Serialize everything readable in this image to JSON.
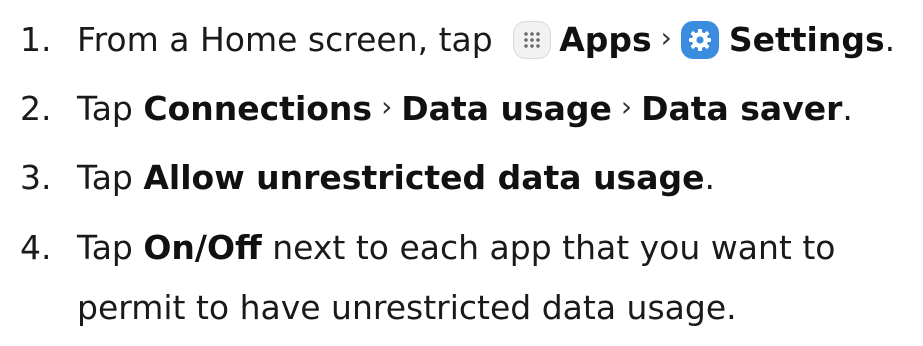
{
  "steps": [
    {
      "num": "1.",
      "t1": "From a Home screen, tap ",
      "apps": "Apps",
      "sep1": "›",
      "settings": "Settings",
      "end": ".",
      "apps_icon": "apps-grid-icon",
      "settings_icon": "gear-icon",
      "settings_icon_color": "#3a8dde"
    },
    {
      "num": "2.",
      "t1": "Tap ",
      "b1": "Connections",
      "sep1": "›",
      "b2": "Data usage",
      "sep2": "›",
      "b3": "Data saver",
      "end": "."
    },
    {
      "num": "3.",
      "t1": "Tap ",
      "b1": "Allow unrestricted data usage",
      "end": "."
    },
    {
      "num": "4.",
      "t1": "Tap ",
      "b1": "On/Off",
      "t2": " next to each app that you want to",
      "line2": "permit to have unrestricted data usage."
    }
  ]
}
